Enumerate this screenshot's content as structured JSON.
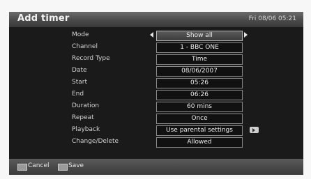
{
  "header": {
    "title": "Add timer",
    "datetime": "Fri 08/06 05:21"
  },
  "fields": [
    {
      "label": "Mode",
      "value": "Show all"
    },
    {
      "label": "Channel",
      "value": "1 - BBC ONE"
    },
    {
      "label": "Record Type",
      "value": "Time"
    },
    {
      "label": "Date",
      "value": "08/06/2007"
    },
    {
      "label": "Start",
      "value": "05:26"
    },
    {
      "label": "End",
      "value": "06:26"
    },
    {
      "label": "Duration",
      "value": "60 mins"
    },
    {
      "label": "Repeat",
      "value": "Once"
    },
    {
      "label": "Playback",
      "value": "Use parental settings"
    },
    {
      "label": "Change/Delete",
      "value": "Allowed"
    }
  ],
  "footer": {
    "cancel_label": "Cancel",
    "save_label": "Save"
  }
}
